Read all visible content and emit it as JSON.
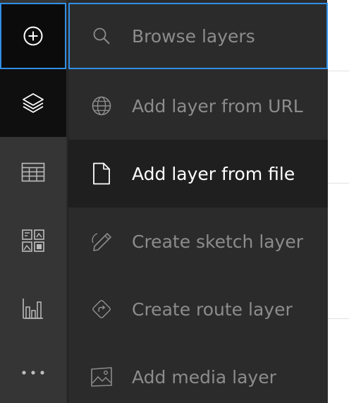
{
  "toolbar": {
    "items": [
      {
        "icon": "plus-circle-icon",
        "state": "focused"
      },
      {
        "icon": "layers-icon",
        "state": "selected"
      },
      {
        "icon": "table-icon",
        "state": "default"
      },
      {
        "icon": "widgets-icon",
        "state": "default"
      },
      {
        "icon": "bar-chart-icon",
        "state": "default"
      },
      {
        "icon": "more-icon",
        "state": "default"
      }
    ]
  },
  "menu": {
    "items": [
      {
        "label": "Browse layers",
        "icon": "search-icon"
      },
      {
        "label": "Add layer from URL",
        "icon": "globe-icon"
      },
      {
        "label": "Add layer from file",
        "icon": "file-icon"
      },
      {
        "label": "Create sketch layer",
        "icon": "pencil-icon"
      },
      {
        "label": "Create route layer",
        "icon": "route-icon"
      },
      {
        "label": "Add media layer",
        "icon": "image-icon"
      }
    ]
  },
  "colors": {
    "focus_ring": "#2f8fe6",
    "menu_bg": "#2b2b2b",
    "menu_active_bg": "#1f1f1f",
    "text_default": "#8c8c8c",
    "text_active": "#ffffff",
    "toolbar_bg": "#353535"
  }
}
